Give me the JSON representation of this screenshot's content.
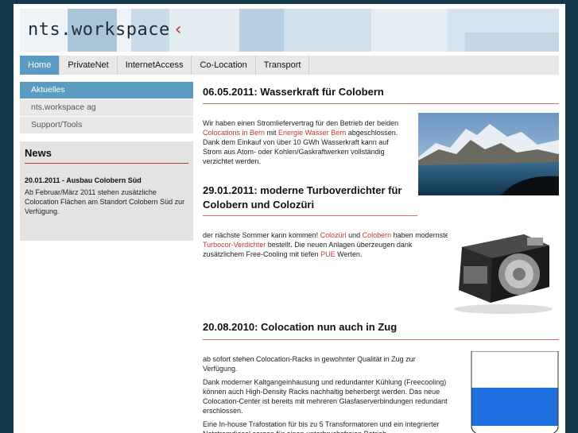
{
  "header": {
    "logo_text": "nts.workspace",
    "logo_chevron": "‹"
  },
  "nav": {
    "tabs": [
      "Home",
      "PrivateNet",
      "InternetAccess",
      "Co-Location",
      "Transport"
    ],
    "active": "Home"
  },
  "sidebar": {
    "items": [
      "Aktuelles",
      "nts.workspace ag",
      "Support/Tools"
    ],
    "news": {
      "heading": "News",
      "item_title": "20.01.2011 - Ausbau Colobern Süd",
      "item_text": "Ab Februar/März 2011 stehen zusätzliche Colocation Flächen am Standort Colobern Süd zur Verfügung."
    }
  },
  "articles": [
    {
      "title": "06.05.2011: Wasserkraft für Colobern",
      "t1": "Wir haben einen Stromliefervertrag für den Betrieb der beiden ",
      "l1": "Colocations in Bern",
      "t2": " mit ",
      "l2": "Energie Wasser Bern",
      "t3": " abgeschlossen. Dank dem Einkauf von über 10 GWh Wasserkraft kann auf Strom aus Atom- oder Kohlen/Gaskraftwerken vollständig verzichtet werden.",
      "image": "mountain-lake-photo"
    },
    {
      "title_line1": "29.01.2011: moderne Turboverdichter für",
      "title_line2": "Colobern und Colozüri",
      "t1": "der nächste Sommer kann kommen! ",
      "l1": "Colozüri",
      "t2": " und ",
      "l2": "Colobern",
      "t3": " haben modernste ",
      "l3": "Turbocor-Verdichter",
      "t4": " bestellt. Die neuen Anlagen überzeugen dank zusätzlichem Free-Cooling mit tiefen ",
      "l4": "PUE",
      "t5": " Werten.",
      "image": "compressor-photo"
    },
    {
      "title": "20.08.2010: Colocation nun auch in Zug",
      "p1": "ab sofort stehen Colocation-Racks in gewohnter Qualität in Zug zur Verfügung.",
      "p2": "Dank moderner Kaltgangeinhausung und redundanter Kühlung (Freecooling) können auch High-Density Racks nachhaltig beherbergt werden. Das neue Colocation-Center ist bereits mit mehreren Glasfaserverbindungen redundant erschlossen.",
      "p3": "Eine In-house Trafostation für bis zu 5 Transformatoren und ein integrierter Notstromdiesel sorgen für einen unterbruchsfreien Betrieb.",
      "image": "zug-coat-of-arms"
    }
  ],
  "colors": {
    "accent": "#5b9bc1",
    "link": "#c0392b",
    "frame": "#14384b",
    "zug_blue": "#1e6fe0"
  }
}
